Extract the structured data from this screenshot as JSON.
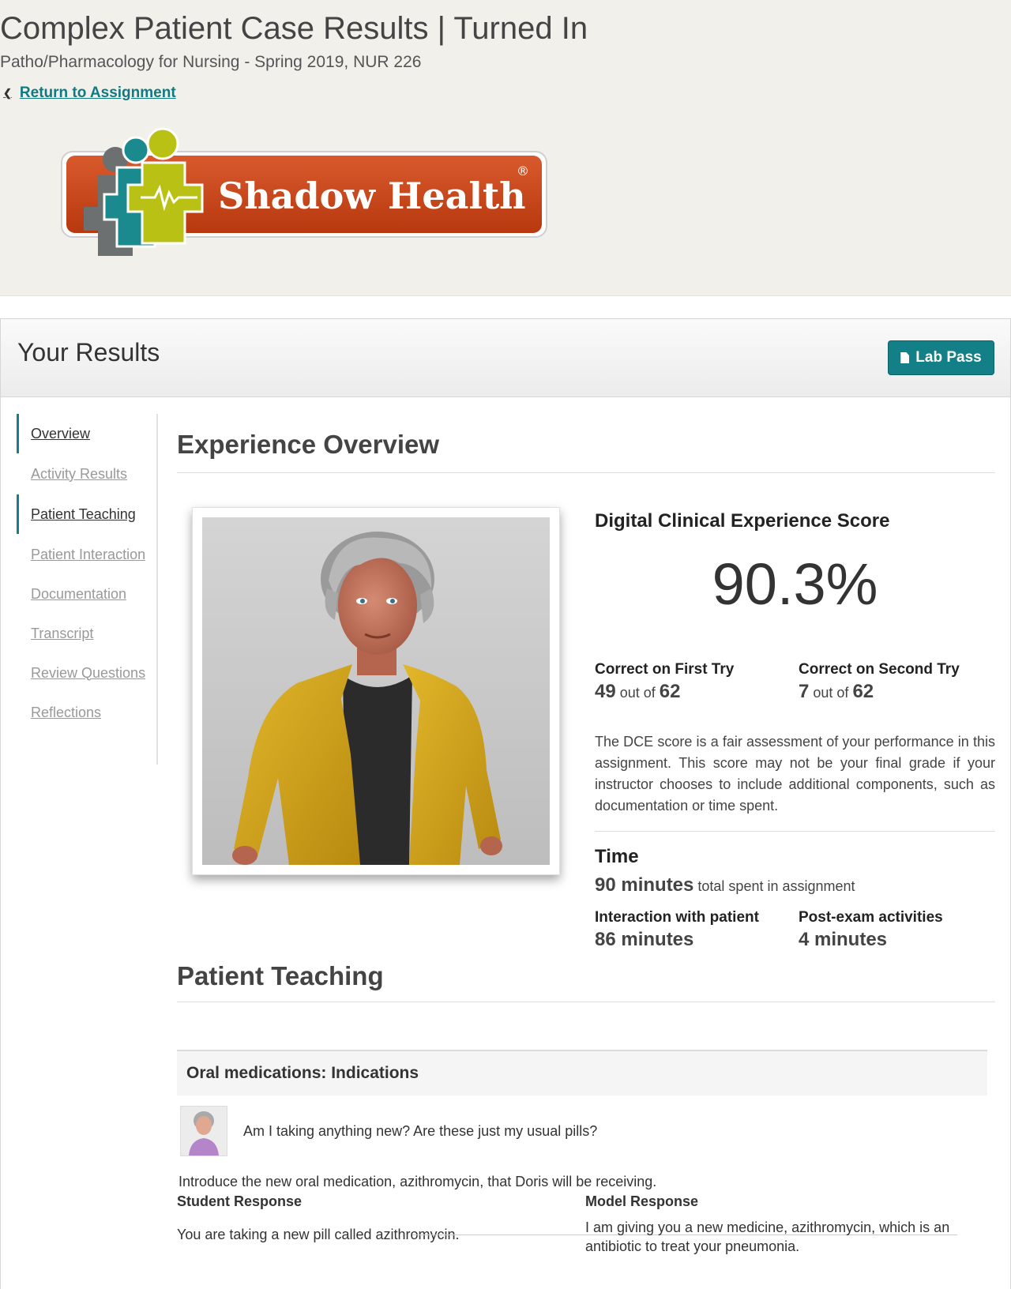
{
  "header": {
    "title": "Complex Patient Case Results | Turned In",
    "subtitle": "Patho/Pharmacology for Nursing - Spring 2019, NUR 226",
    "return_link": "Return to Assignment",
    "logo_text": "Shadow Health",
    "logo_mark": "®"
  },
  "results": {
    "title": "Your Results",
    "lab_pass_label": "Lab Pass",
    "lab_pass_icon": "document-icon"
  },
  "sidebar": {
    "items": [
      {
        "label": "Overview",
        "active": true
      },
      {
        "label": "Activity Results",
        "active": false
      },
      {
        "label": "Patient Teaching",
        "active": true
      },
      {
        "label": "Patient Interaction",
        "active": false
      },
      {
        "label": "Documentation",
        "active": false
      },
      {
        "label": "Transcript",
        "active": false
      },
      {
        "label": "Review Questions",
        "active": false
      },
      {
        "label": "Reflections",
        "active": false
      }
    ]
  },
  "overview": {
    "heading": "Experience Overview",
    "dce_title": "Digital Clinical Experience Score",
    "score": "90.3%",
    "first_try_label": "Correct on First Try",
    "first_try_value": "49",
    "first_try_total": "62",
    "second_try_label": "Correct on Second Try",
    "second_try_value": "7",
    "second_try_total": "62",
    "out_of": "out of",
    "description": "The DCE score is a fair assessment of your performance in this assignment. This score may not be your final grade if your instructor chooses to include additional components, such as documentation or time spent.",
    "time_heading": "Time",
    "time_total": "90 minutes",
    "time_total_suffix": "total spent in assignment",
    "interaction_label": "Interaction with patient",
    "interaction_value": "86 minutes",
    "post_exam_label": "Post-exam activities",
    "post_exam_value": "4 minutes"
  },
  "teaching": {
    "heading": "Patient Teaching",
    "topic": "Oral medications: Indications",
    "patient_question": "Am I taking anything new? Are these just my usual pills?",
    "prompt": "Introduce the new oral medication, azithromycin, that Doris will be receiving.",
    "student_label": "Student Response",
    "student_response": "You are taking a new pill called azithromycin.",
    "model_label": "Model Response",
    "model_response": "I am giving you a new medicine, azithromycin, which is an antibiotic to treat your pneumonia."
  },
  "colors": {
    "accent": "#137f86",
    "logo_orange": "#c9421b",
    "logo_teal": "#1b8a8f",
    "logo_lime": "#b9c214",
    "top_background": "#f2f0ea"
  }
}
